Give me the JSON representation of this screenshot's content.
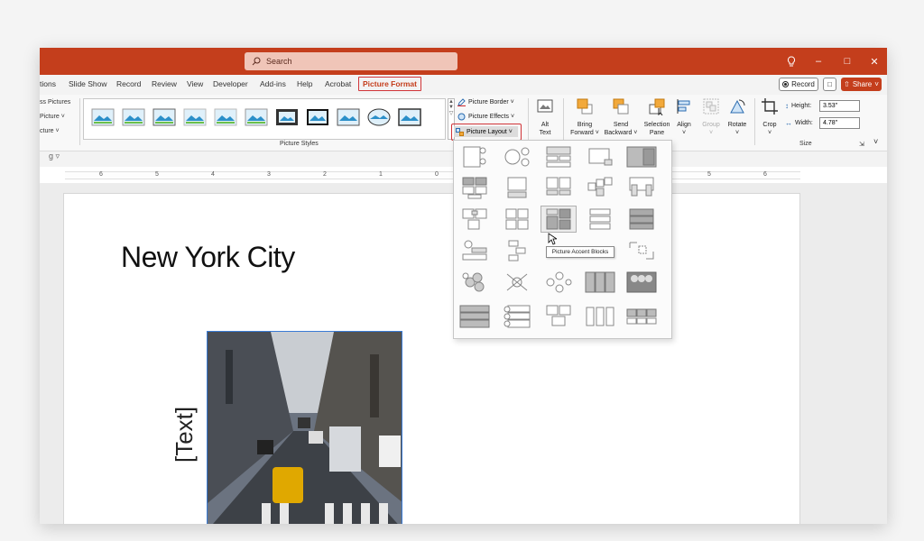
{
  "search": {
    "placeholder": "Search"
  },
  "window_controls": {
    "lightbulb": "♔",
    "minimize": "–",
    "maximize": "□",
    "close": "✕"
  },
  "tabs": [
    {
      "label": "tions"
    },
    {
      "label": "Slide Show"
    },
    {
      "label": "Record"
    },
    {
      "label": "Review"
    },
    {
      "label": "View"
    },
    {
      "label": "Developer"
    },
    {
      "label": "Add-ins"
    },
    {
      "label": "Help"
    },
    {
      "label": "Acrobat"
    },
    {
      "label": "Picture Format",
      "active": true
    }
  ],
  "header_buttons": {
    "record": "Record",
    "share": "Share"
  },
  "ribbon": {
    "left_items": [
      "ss Pictures",
      "Picture ˅",
      "cture ˅"
    ],
    "picture_styles_label": "Picture Styles",
    "picture_border": "Picture Border ˅",
    "picture_effects": "Picture Effects ˅",
    "picture_layout": "Picture Layout ˅",
    "alt_text": [
      "Alt",
      "Text"
    ],
    "bring_forward": [
      "Bring",
      "Forward ˅"
    ],
    "send_backward": [
      "Send",
      "Backward ˅"
    ],
    "selection_pane": [
      "Selection",
      "Pane"
    ],
    "align": [
      "Align",
      "˅"
    ],
    "group": [
      "Group",
      "˅"
    ],
    "rotate": [
      "Rotate",
      "˅"
    ],
    "crop": [
      "Crop",
      "˅"
    ],
    "height_label": "Height:",
    "height_value": "3.53\"",
    "width_label": "Width:",
    "width_value": "4.78\"",
    "size_label": "Size"
  },
  "qat": {
    "text": "g  ▿"
  },
  "ruler": {
    "labels": [
      "6",
      "5",
      "4",
      "3",
      "2",
      "1",
      "0",
      "5",
      "6"
    ]
  },
  "slide": {
    "title": "New York City",
    "placeholder_text": "[Text]"
  },
  "layout_gallery": {
    "tooltip": "Picture Accent Blocks",
    "rows": 6,
    "cols": 5,
    "highlighted": "r2c2"
  },
  "colors": {
    "accent": "#c43e1c",
    "highlight_border": "#d13438",
    "selection": "#3a7bd5"
  }
}
